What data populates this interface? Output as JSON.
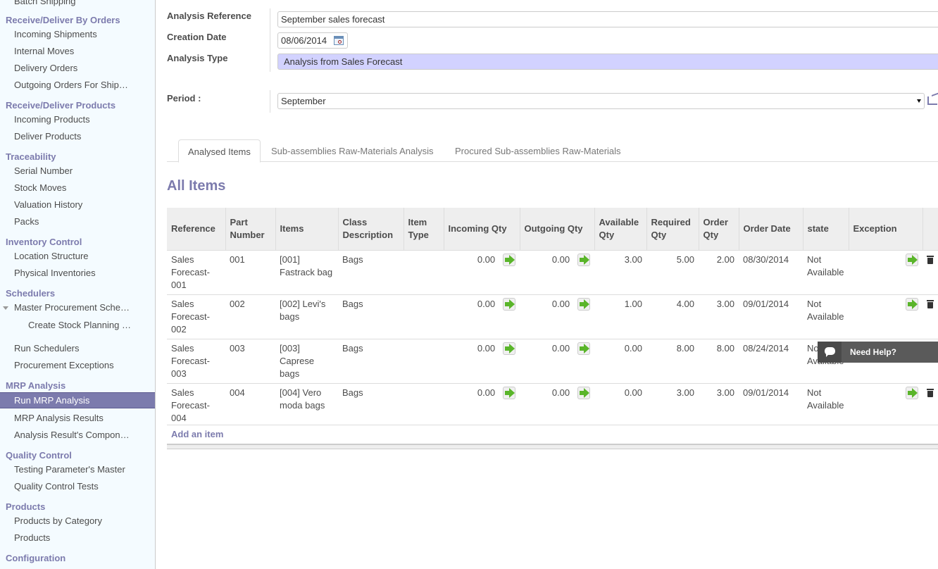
{
  "sidebar": {
    "top_partial": "Batch Shipping",
    "sections": [
      {
        "title": "Receive/Deliver By Orders",
        "items": [
          "Incoming Shipments",
          "Internal Moves",
          "Delivery Orders",
          "Outgoing Orders For Ship…"
        ]
      },
      {
        "title": "Receive/Deliver Products",
        "items": [
          "Incoming Products",
          "Deliver Products"
        ]
      },
      {
        "title": "Traceability",
        "items": [
          "Serial Number",
          "Stock Moves",
          "Valuation History",
          "Packs"
        ]
      },
      {
        "title": "Inventory Control",
        "items": [
          "Location Structure",
          "Physical Inventories"
        ]
      },
      {
        "title": "Schedulers",
        "items": [
          "Master Procurement Sche…",
          "Create Stock Planning …",
          "Run Schedulers",
          "Procurement Exceptions"
        ]
      },
      {
        "title": "MRP Analysis",
        "items": [
          "Run MRP Analysis",
          "MRP Analysis Results",
          "Analysis Result's Compon…"
        ]
      },
      {
        "title": "Quality Control",
        "items": [
          "Testing Parameter's Master",
          "Quality Control Tests"
        ]
      },
      {
        "title": "Products",
        "items": [
          "Products by Category",
          "Products"
        ]
      },
      {
        "title": "Configuration",
        "items": []
      }
    ],
    "active_item": "Run MRP Analysis"
  },
  "form": {
    "analysis_reference": {
      "label": "Analysis Reference",
      "value": "September sales forecast"
    },
    "creation_date": {
      "label": "Creation Date",
      "value": "08/06/2014"
    },
    "analysis_type": {
      "label": "Analysis Type",
      "value": "Analysis from Sales Forecast"
    },
    "period": {
      "label": "Period :",
      "value": "September"
    }
  },
  "tabs": [
    {
      "label": "Analysed Items",
      "active": true
    },
    {
      "label": "Sub-assemblies Raw-Materials Analysis",
      "active": false
    },
    {
      "label": "Procured Sub-assemblies Raw-Materials",
      "active": false
    }
  ],
  "section_title": "All Items",
  "table": {
    "columns": [
      "Reference",
      "Part Number",
      "Items",
      "Class Description",
      "Item Type",
      "Incoming Qty",
      "Outgoing Qty",
      "Available Qty",
      "Required Qty",
      "Order Qty",
      "Order Date",
      "state",
      "Exception"
    ],
    "rows": [
      {
        "reference": "Sales Forecast-001",
        "part": "001",
        "item": "[001] Fastrack bag",
        "class": "Bags",
        "type": "",
        "incoming": "0.00",
        "outgoing": "0.00",
        "available": "3.00",
        "required": "5.00",
        "order": "2.00",
        "date": "08/30/2014",
        "state": "Not Available",
        "exception": ""
      },
      {
        "reference": "Sales Forecast-002",
        "part": "002",
        "item": "[002] Levi's bags",
        "class": "Bags",
        "type": "",
        "incoming": "0.00",
        "outgoing": "0.00",
        "available": "1.00",
        "required": "4.00",
        "order": "3.00",
        "date": "09/01/2014",
        "state": "Not Available",
        "exception": ""
      },
      {
        "reference": "Sales Forecast-003",
        "part": "003",
        "item": "[003] Caprese bags",
        "class": "Bags",
        "type": "",
        "incoming": "0.00",
        "outgoing": "0.00",
        "available": "0.00",
        "required": "8.00",
        "order": "8.00",
        "date": "08/24/2014",
        "state": "Not Available",
        "exception": ""
      },
      {
        "reference": "Sales Forecast-004",
        "part": "004",
        "item": "[004] Vero moda bags",
        "class": "Bags",
        "type": "",
        "incoming": "0.00",
        "outgoing": "0.00",
        "available": "0.00",
        "required": "3.00",
        "order": "3.00",
        "date": "09/01/2014",
        "state": "Not Available",
        "exception": ""
      }
    ],
    "add_item_label": "Add an item"
  },
  "help_widget": {
    "label": "Need Help?"
  },
  "colors": {
    "accent": "#7c7bad",
    "selected_field": "#d2d2ff",
    "sidebar_bg": "#f4fbff"
  }
}
